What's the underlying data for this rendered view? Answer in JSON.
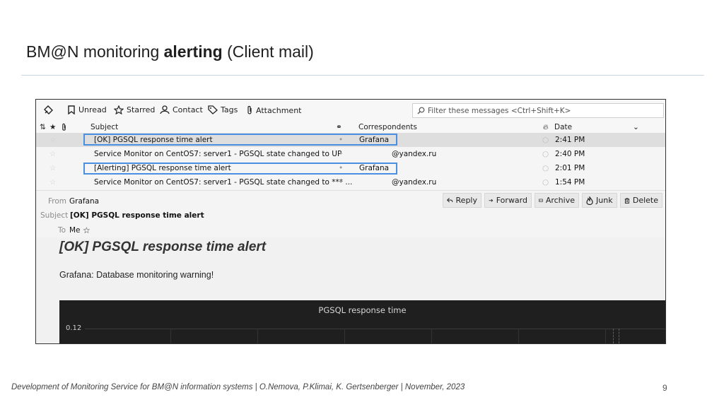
{
  "slide": {
    "title_prefix": "BM@N monitoring ",
    "title_bold": "alerting",
    "title_suffix": " (Client mail)",
    "footer": "Development of Monitoring Service for BM@N information systems | O.Nemova, P.Klimai, K. Gertsenberger  | November, 2023",
    "page_number": "9"
  },
  "toolbar": {
    "unread": "Unread",
    "starred": "Starred",
    "contact": "Contact",
    "tags": "Tags",
    "attachment": "Attachment",
    "filter_placeholder": "Filter these messages <Ctrl+Shift+K>"
  },
  "columns": {
    "subject": "Subject",
    "correspondents": "Correspondents",
    "date": "Date"
  },
  "messages": [
    {
      "subject": "[OK] PGSQL response time alert",
      "correspondent": "Grafana",
      "date": "2:41 PM"
    },
    {
      "subject": "Service Monitor on CentOS7: server1 - PGSQL state changed to UP",
      "correspondent": "@yandex.ru",
      "date": "2:40 PM"
    },
    {
      "subject": "[Alerting] PGSQL response time alert",
      "correspondent": "Grafana",
      "date": "2:01 PM"
    },
    {
      "subject": "Service Monitor on CentOS7: server1 - PGSQL state changed to *** ...",
      "correspondent": "@yandex.ru",
      "date": "1:54 PM"
    }
  ],
  "message_header": {
    "from_label": "From",
    "from_value": "Grafana",
    "subject_label": "Subject",
    "subject_value": "[OK] PGSQL response time alert",
    "to_label": "To",
    "to_value": "Me"
  },
  "actions": {
    "reply": "Reply",
    "forward": "Forward",
    "archive": "Archive",
    "junk": "Junk",
    "delete": "Delete"
  },
  "message_body": {
    "heading": "[OK] PGSQL response time alert",
    "text": "Grafana: Database monitoring warning!",
    "panel_title": "PGSQL response time",
    "panel_y_tick": "0.12"
  },
  "colors": {
    "highlight": "#4a8fe0",
    "selected_row": "#dedede",
    "panel_bg": "#1f1f1f"
  }
}
